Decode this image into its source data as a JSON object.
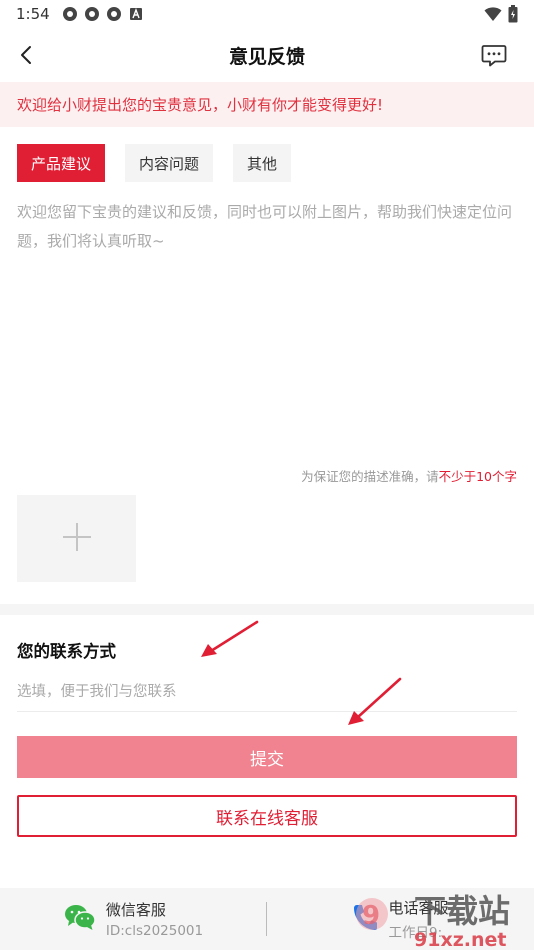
{
  "status": {
    "time": "1:54"
  },
  "nav": {
    "title": "意见反馈"
  },
  "notice": {
    "text": "欢迎给小财提出您的宝贵意见，小财有你才能变得更好!"
  },
  "tabs": [
    {
      "label": "产品建议",
      "active": true
    },
    {
      "label": "内容问题",
      "active": false
    },
    {
      "label": "其他",
      "active": false
    }
  ],
  "feedback": {
    "placeholder": "欢迎您留下宝贵的建议和反馈，同时也可以附上图片，帮助我们快速定位问题，我们将认真听取~",
    "hint_prefix": "为保证您的描述准确，请",
    "hint_highlight": "不少于10个字"
  },
  "contact": {
    "title": "您的联系方式",
    "placeholder": "选填，便于我们与您联系"
  },
  "buttons": {
    "submit": "提交",
    "online_service": "联系在线客服"
  },
  "bottom": {
    "wechat_title": "微信客服",
    "wechat_id": "ID:cls2025001",
    "phone_title": "电话客服",
    "phone_sub": "工作日9:"
  },
  "watermark": {
    "brand": "下载站",
    "site": "91xz.net"
  },
  "colors": {
    "accent": "#e01e34",
    "submit_disabled": "#f0838f",
    "notice_bg": "#fdf0f1"
  }
}
